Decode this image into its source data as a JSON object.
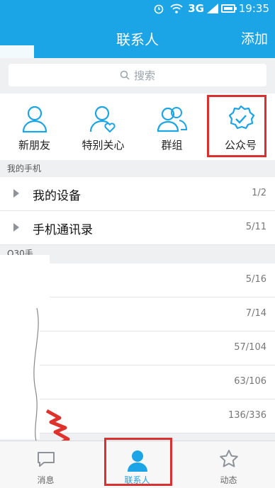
{
  "status": {
    "network": "3G",
    "time": "19:35"
  },
  "nav": {
    "title": "联系人",
    "add_label": "添加"
  },
  "search": {
    "placeholder": "搜索"
  },
  "quick_actions": [
    {
      "label": "新朋友"
    },
    {
      "label": "特别关心"
    },
    {
      "label": "群组"
    },
    {
      "label": "公众号"
    }
  ],
  "sections": {
    "my_phone": "我的手机",
    "second": "Q30手"
  },
  "rows": [
    {
      "name": "我的设备",
      "count": "1/2"
    },
    {
      "name": "手机通讯录",
      "count": "5/11"
    },
    {
      "name": "",
      "count": "5/16"
    },
    {
      "name": "",
      "count": "7/14"
    },
    {
      "name": "",
      "count": "57/104"
    },
    {
      "name": "",
      "count": "63/106"
    },
    {
      "name": "",
      "count": "136/336"
    }
  ],
  "tabs": [
    {
      "label": "消息"
    },
    {
      "label": "联系人"
    },
    {
      "label": "动态"
    }
  ],
  "colors": {
    "accent": "#1ba4e6",
    "highlight": "#d9312f"
  }
}
